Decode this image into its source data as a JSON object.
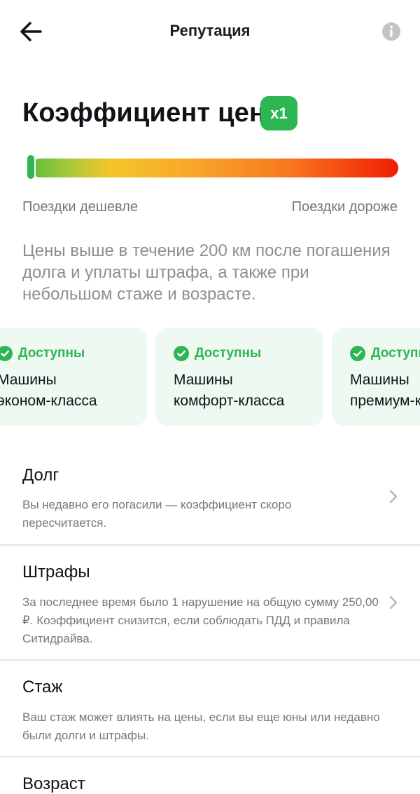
{
  "header": {
    "title": "Репутация"
  },
  "coefficient": {
    "title": "Коэффициент цен",
    "badge": "x1",
    "value": 1,
    "scale_level_fraction": 0.0,
    "scale_left_label": "Поездки дешевле",
    "scale_right_label": "Поездки дороже",
    "description": "Цены выше в течение 200 км после погашения долга и уплаты штрафа, а также при небольшом стаже и возрасте."
  },
  "cards": [
    {
      "status": "Доступны",
      "name_line1": "Машины",
      "name_line2": "эконом-класса"
    },
    {
      "status": "Доступны",
      "name_line1": "Машины",
      "name_line2": "комфорт-класса"
    },
    {
      "status": "Доступны",
      "name_line1": "Машины",
      "name_line2": "премиум-класса"
    }
  ],
  "factors": [
    {
      "title": "Долг",
      "text": "Вы недавно его погасили — коэффициент скоро пересчитается."
    },
    {
      "title": "Штрафы",
      "text": "За последнее время было 1 нарушение на общую сумму 250,00 ₽. Коэффициент снизится, если соблюдать ПДД и правила Ситидрайва."
    },
    {
      "title": "Стаж",
      "text": "Ваш стаж может влиять на цены, если вы еще юны или недавно были долги и штрафы."
    },
    {
      "title": "Возраст"
    }
  ],
  "colors": {
    "accent_green": "#2db653",
    "card_background": "#eef9f1",
    "scale_start": "#5dbd3a",
    "scale_end": "#f21e08"
  },
  "icons": {
    "back": "arrow-left-icon",
    "info": "info-icon",
    "status": "check-circle-icon",
    "row": "chevron-right-icon"
  }
}
